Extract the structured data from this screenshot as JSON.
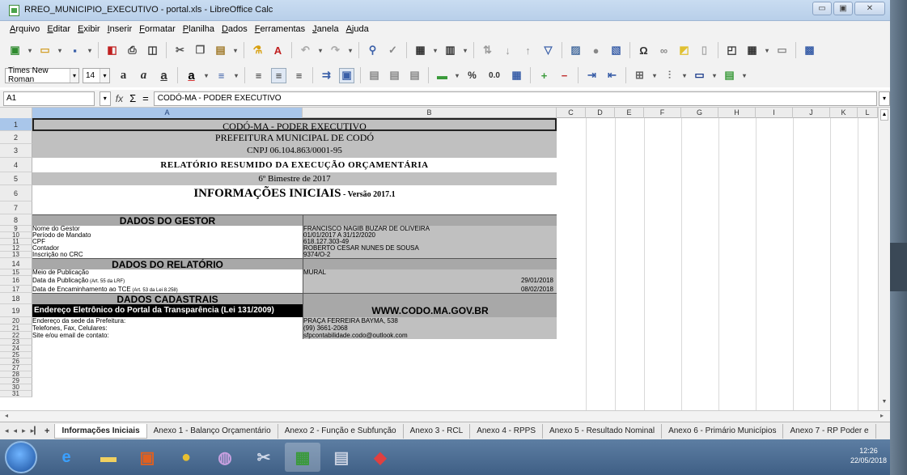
{
  "window": {
    "title": "RREO_MUNICIPIO_EXECUTIVO - portal.xls - LibreOffice Calc",
    "min": "▭",
    "max": "▣",
    "close": "✕"
  },
  "menu": [
    "Arquivo",
    "Editar",
    "Exibir",
    "Inserir",
    "Formatar",
    "Planilha",
    "Dados",
    "Ferramentas",
    "Janela",
    "Ajuda"
  ],
  "format": {
    "font": "Times New Roman",
    "size": "14",
    "percent": "%",
    "decimal": "0.0"
  },
  "formula": {
    "cellref": "A1",
    "content": "CODÓ-MA - PODER EXECUTIVO",
    "fx": "fx",
    "sum": "Σ",
    "eq": "="
  },
  "columns": [
    "A",
    "B",
    "C",
    "D",
    "E",
    "F",
    "G",
    "H",
    "I",
    "J",
    "K",
    "L"
  ],
  "rows": [
    "1",
    "2",
    "3",
    "4",
    "5",
    "6",
    "7",
    "8",
    "9",
    "10",
    "11",
    "12",
    "13",
    "14",
    "15",
    "16",
    "17",
    "18",
    "19",
    "20",
    "21",
    "22",
    "23",
    "24",
    "25",
    "26",
    "27",
    "28",
    "29",
    "30",
    "31"
  ],
  "sheet": {
    "r1": "CODÓ-MA - PODER EXECUTIVO",
    "r2": "PREFEITURA MUNICIPAL DE CODÓ",
    "r3": "CNPJ 06.104.863/0001-95",
    "r4": "RELATÓRIO RESUMIDO DA EXECUÇÃO ORÇAMENTÁRIA",
    "r5": "6º Bimestre de 2017",
    "r6": "INFORMAÇÕES INICIAIS",
    "r6b": " - Versão 2017.1",
    "r8": "DADOS DO GESTOR",
    "r9a": "Nome do Gestor",
    "r9b": "FRANCISCO NAGIB BUZAR DE OLIVEIRA",
    "r10a": "Período de Mandato",
    "r10b": "01/01/2017 A 31/12/2020",
    "r11a": "CPF",
    "r11b": "618.127.303-49",
    "r12a": "Contador",
    "r12b": "ROBERTO CESAR NUNES DE SOUSA",
    "r13a": "Inscrição no CRC",
    "r13b": "9374/O-2",
    "r14": "DADOS DO RELATÓRIO",
    "r15a": "Meio de Publicação",
    "r15b": "MURAL",
    "r16a": "Data da Publicação",
    "r16n": " (Art. 55 da LRF)",
    "r16b": "29/01/2018",
    "r17a": "Data de Encaminhamento ao TCE",
    "r17n": " (Art. 53 da Lei 8.258)",
    "r17b": "08/02/2018",
    "r18": "DADOS CADASTRAIS",
    "r19a": "Endereço Eletrônico do Portal da Transparência (Lei 131/2009)",
    "r19b": "WWW.CODO.MA.GOV.BR",
    "r20a": "Endereço da sede da Prefeitura:",
    "r20b": "PRAÇA FERREIRA BAYMA, 538",
    "r21a": "Telefones, Fax, Celulares:",
    "r21b": "(99) 3661-2068",
    "r22a": "Site e/ou email de contato:",
    "r22b": "sfpcontabilidade.codo@outlook.com"
  },
  "tabs": [
    "Informações Iniciais",
    "Anexo 1 - Balanço Orçamentário",
    "Anexo 2 - Função e Subfunção",
    "Anexo 3 - RCL",
    "Anexo 4 - RPPS",
    "Anexo 5 - Resultado Nominal",
    "Anexo 6 - Primário Municípios",
    "Anexo 7 - RP Poder e"
  ],
  "clock": {
    "time": "12:26",
    "date": "22/05/2018"
  }
}
